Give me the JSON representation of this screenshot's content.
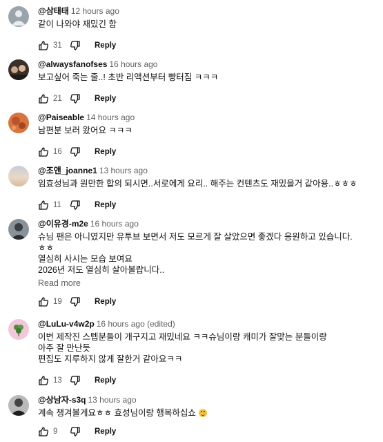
{
  "reply_label": "Reply",
  "read_more_label": "Read more",
  "colors": {
    "text": "#0f0f0f",
    "secondary": "#606060",
    "emoji": "#f5c242"
  },
  "comments": [
    {
      "author": "@삼태태",
      "time": "12 hours ago",
      "lines": [
        "같이 나와야 재밌긴 함"
      ],
      "likes": "31"
    },
    {
      "author": "@alwaysfanofses",
      "time": "16 hours ago",
      "lines": [
        "보고싶어 죽는 줄..! 초반 리액션부터 빵터짐 ㅋㅋㅋ"
      ],
      "likes": "21"
    },
    {
      "author": "@Paiseable",
      "time": "14 hours ago",
      "lines": [
        "남편분 보러 왔어요 ㅋㅋㅋ"
      ],
      "likes": "16"
    },
    {
      "author": "@조앤_joanne1",
      "time": "13 hours ago",
      "lines": [
        "임효성님과 원만한 합의 되시면..서로에게 요리.. 해주는 컨텐츠도 재밌을거 같아용..ㅎㅎㅎ"
      ],
      "likes": "11"
    },
    {
      "author": "@이유경-m2e",
      "time": "16 hours ago",
      "lines": [
        "슈님 팬은 아니였지만 유투브 보면서 저도 모르게 잘 살았으면 좋겠다 응원하고 있습니다.",
        "ㅎㅎ",
        "열심히 사시는 모습 보여요",
        "2026년 저도 열심히 살아볼랍니다.."
      ],
      "likes": "19"
    },
    {
      "author": "@LuLu-v4w2p",
      "time": "16 hours ago (edited)",
      "lines": [
        "이번 제작진 스텝분들이 개구지고 재밌네요 ㅋㅋ슈님이랑 캐미가 잘맞는 분들이랑",
        "아주 잘 만난듯",
        "편집도 지루하지 않게 잘한거 같아요ㅋㅋ"
      ],
      "likes": "13"
    },
    {
      "author": "@상남자-s3q",
      "time": "13 hours ago",
      "lines": [
        "계속 챙겨볼게요ㅎㅎ 효성님이랑 행복하십쇼"
      ],
      "likes": "9"
    }
  ]
}
